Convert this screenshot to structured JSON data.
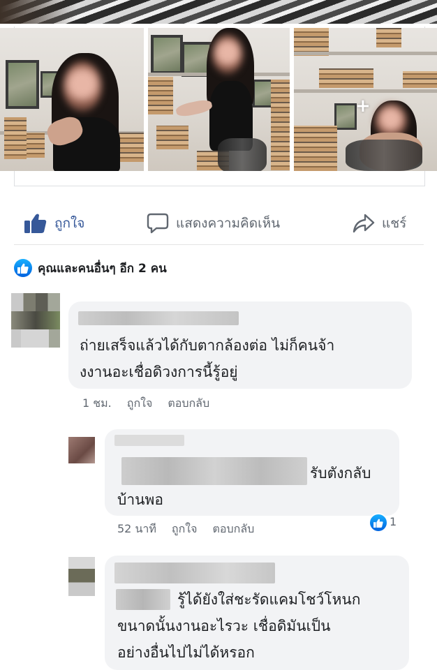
{
  "actions": {
    "like_label": "ถูกใจ",
    "comment_label": "แสดงความคิดเห็น",
    "share_label": "แชร์"
  },
  "reactions": {
    "summary": "คุณและคนอื่นๆ อีก 2 คน"
  },
  "photos": {
    "more_label": "+"
  },
  "comments": [
    {
      "text": "ถ่ายเสร็จแล้วได้กับตากล้องต่อ ไม่ก็คนจ้างงานอะเชื่อดิวงการนี้รู้อยู่",
      "line1": "ถ่ายเสร็จแล้วได้กับตากล้องต่อ ไม่ก็คนจ้า",
      "line2": "งงานอะเชื่อดิวงการนี้รู้อยู่",
      "time": "1 ชม.",
      "like": "ถูกใจ",
      "reply": "ตอบกลับ"
    },
    {
      "line1_tail": "รับตังกลับ",
      "line2": "บ้านพอ",
      "time": "52 นาที",
      "like": "ถูกใจ",
      "reply": "ตอบกลับ",
      "like_count": "1"
    },
    {
      "line1_tail": "รู้ได้ยังใส่ชะรัดแคมโชว์โหนก",
      "line2": "ขนาดนั้นงานอะไรวะ เชื่อดิมันเป็น",
      "line3": "อย่างอื่นไปไม่ได้หรอก"
    }
  ],
  "colors": {
    "link_blue": "#365899",
    "like_gradient_top": "#18afff",
    "like_gradient_bottom": "#0062df",
    "bubble_bg": "#f2f3f5",
    "meta_text": "#606770"
  },
  "icons": [
    "thumbs-up-icon",
    "comment-icon",
    "share-icon",
    "like-badge-icon"
  ]
}
